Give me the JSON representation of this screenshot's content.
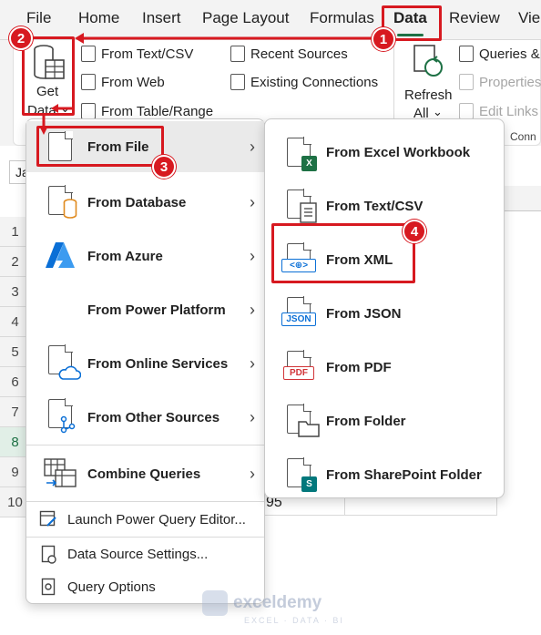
{
  "ribbon_tabs": {
    "file": "File",
    "home": "Home",
    "insert": "Insert",
    "page_layout": "Page Layout",
    "formulas": "Formulas",
    "data": "Data",
    "review": "Review",
    "view": "Vie"
  },
  "ribbon": {
    "get_data_line1": "Get",
    "get_data_line2": "Data",
    "get_data_chevron": "⌄",
    "from_text_csv": "From Text/CSV",
    "from_web": "From Web",
    "from_table_range": "From Table/Range",
    "recent_sources": "Recent Sources",
    "existing_connections": "Existing Connections",
    "refresh_line1": "Refresh",
    "refresh_line2": "All",
    "refresh_chevron": "⌄",
    "queries_conn": "Queries &",
    "properties": "Properties",
    "edit_links": "Edit Links",
    "group_label_partial": "Conn"
  },
  "sheet": {
    "name_box": "Ja",
    "row_numbers": [
      "1",
      "2",
      "3",
      "4",
      "5",
      "6",
      "7",
      "8",
      "9",
      "10"
    ],
    "selected_row": "8",
    "partial_cell_value": "95"
  },
  "menu_main": {
    "items": [
      {
        "label": "From File",
        "chevron": "›"
      },
      {
        "label": "From Database",
        "chevron": "›"
      },
      {
        "label": "From Azure",
        "chevron": "›"
      },
      {
        "label": "From Power Platform",
        "chevron": "›"
      },
      {
        "label": "From Online Services",
        "chevron": "›"
      },
      {
        "label": "From Other Sources",
        "chevron": "›"
      },
      {
        "label": "Combine Queries",
        "chevron": "›"
      }
    ],
    "footer_items": [
      {
        "label": "Launch Power Query Editor..."
      },
      {
        "label": "Data Source Settings..."
      },
      {
        "label": "Query Options"
      }
    ]
  },
  "menu_sub": {
    "items": [
      {
        "label": "From Excel Workbook",
        "badge": "X"
      },
      {
        "label": "From Text/CSV"
      },
      {
        "label": "From XML",
        "badge": "<⊕>"
      },
      {
        "label": "From JSON",
        "badge": "JSON"
      },
      {
        "label": "From PDF",
        "badge": "PDF"
      },
      {
        "label": "From Folder"
      },
      {
        "label": "From SharePoint Folder",
        "badge": "S"
      }
    ]
  },
  "annotations": {
    "step1": "1",
    "step2": "2",
    "step3": "3",
    "step4": "4",
    "color": "#d71920"
  },
  "watermark": {
    "name": "exceldemy",
    "tagline": "EXCEL · DATA · BI"
  },
  "colors": {
    "excel_green": "#1e7145",
    "azure_blue": "#0a6fd6",
    "database_orange": "#e08a1e",
    "pdf_red": "#d13438",
    "sharepoint_teal": "#03787c"
  }
}
